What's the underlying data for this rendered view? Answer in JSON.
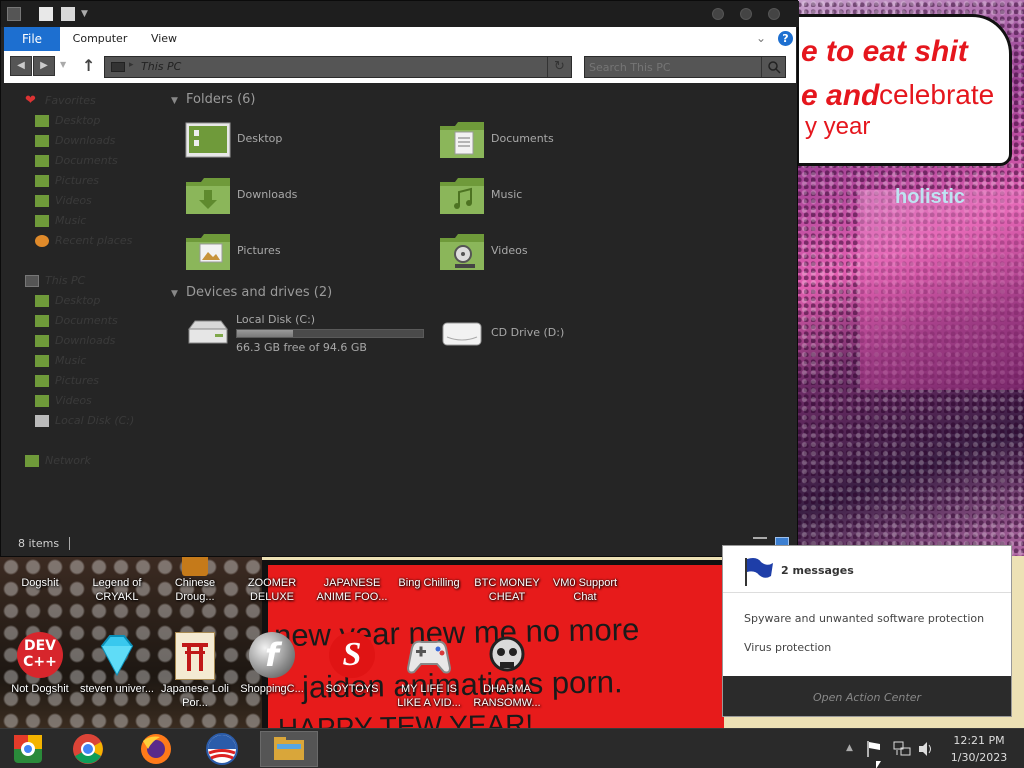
{
  "wallpaper": {
    "bubble_lines": [
      "e to eat shit",
      "e and",
      "celebrate",
      "y year"
    ],
    "bubble_sign": "holistic",
    "red_lines": [
      "new year new me no more",
      "jaiden animations porn.",
      "HAPPY TEW YEAR!"
    ]
  },
  "explorer": {
    "ribbon": {
      "file": "File",
      "computer": "Computer",
      "view": "View"
    },
    "address": "This PC",
    "search_placeholder": "Search This PC",
    "nav": {
      "favorites": "Favorites",
      "fav_items": [
        "Desktop",
        "Downloads",
        "Documents",
        "Pictures",
        "Videos",
        "Music",
        "Recent places"
      ],
      "this_pc": "This PC",
      "pc_items": [
        "Desktop",
        "Documents",
        "Downloads",
        "Music",
        "Pictures",
        "Videos",
        "Local Disk (C:)"
      ],
      "network": "Network"
    },
    "folders_header": "Folders (6)",
    "folders": [
      "Desktop",
      "Documents",
      "Downloads",
      "Music",
      "Pictures",
      "Videos"
    ],
    "devices_header": "Devices and drives (2)",
    "local_disk": {
      "name": "Local Disk (C:)",
      "free": "66.3 GB free of 94.6 GB",
      "used_fraction": 0.3
    },
    "cd_drive": "CD Drive (D:)",
    "status": "8 items"
  },
  "desktop_icons": [
    {
      "label": "Dogshit"
    },
    {
      "label": "Legend of CRYAKL"
    },
    {
      "label": "Chinese Droug..."
    },
    {
      "label": "ZOOMER DELUXE"
    },
    {
      "label": "JAPANESE ANIME FOO..."
    },
    {
      "label": "Bing Chilling"
    },
    {
      "label": "BTC MONEY CHEAT"
    },
    {
      "label": "VM0 Support Chat"
    },
    {
      "label": "Not Dogshit"
    },
    {
      "label": "steven univer..."
    },
    {
      "label": "Japanese Loli Por..."
    },
    {
      "label": "ShoppingC..."
    },
    {
      "label": "SOYTOYS"
    },
    {
      "label": "MY LIFE IS LIKE A VID..."
    },
    {
      "label": "DHARMA RANSOMW..."
    }
  ],
  "devcpp_text": [
    "DEV",
    "C++"
  ],
  "notification": {
    "title": "2 messages",
    "items": [
      "Spyware and unwanted software protection",
      "Virus protection"
    ],
    "footer": "Open Action Center"
  },
  "taskbar": {
    "time": "12:21 PM",
    "date": "1/30/2023"
  },
  "colors": {
    "accent": "#1d6fd0",
    "folder_green": "#7fa84a",
    "taskbar": "#2a2a2a"
  }
}
